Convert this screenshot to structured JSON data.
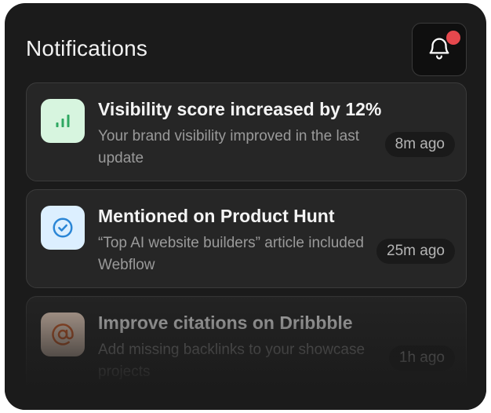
{
  "header": {
    "title": "Notifications",
    "bell_icon": "bell-icon",
    "has_unread": true,
    "unread_color": "#e5484d"
  },
  "notifications": [
    {
      "title": "Visibility score increased by 12%",
      "description": "Your brand visibility improved in the last update",
      "time": "8m ago",
      "icon": "bar-chart-icon",
      "icon_bg": "#d7f5df",
      "icon_color": "#2fa862"
    },
    {
      "title": "Mentioned on Product Hunt",
      "description": "“Top AI website builders” article included Webflow",
      "time": "25m ago",
      "icon": "check-circle-icon",
      "icon_bg": "#dcefff",
      "icon_color": "#2b86d6"
    },
    {
      "title": "Improve citations on Dribbble",
      "description": "Add missing backlinks to your showcase projects",
      "time": "1h ago",
      "icon": "at-sign-icon",
      "icon_bg": "#f7dcc9",
      "icon_color": "#d9622b"
    }
  ]
}
